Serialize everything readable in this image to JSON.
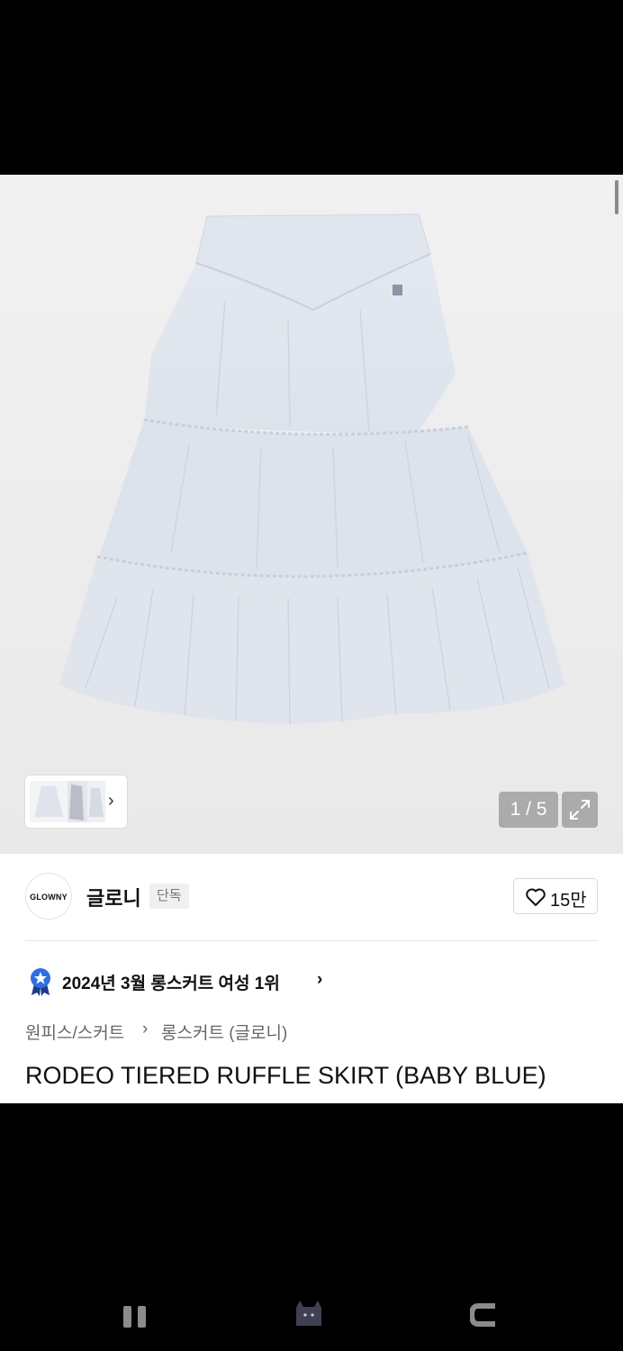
{
  "gallery": {
    "page_counter": "1 / 5",
    "current_image": 1,
    "total_images": 5,
    "product_color": "#dfe5ee"
  },
  "brand": {
    "logo_text": "GLOWNY",
    "name": "글로니",
    "badge": "단독"
  },
  "like": {
    "count": "15만"
  },
  "ranking": {
    "text": "2024년 3월 롱스커트 여성 1위",
    "chevron": "›"
  },
  "breadcrumb": {
    "category": "원피스/스커트",
    "separator": "›",
    "subcategory": "롱스커트 (글로니)"
  },
  "product": {
    "title": "RODEO TIERED RUFFLE SKIRT (BABY BLUE)"
  },
  "icons": {
    "thumbnail_next": "›",
    "expand": "expand-icon",
    "heart": "heart-icon",
    "ranking": "ribbon-badge-icon",
    "recents": "recent-apps-icon",
    "home": "home-icon",
    "back": "back-icon"
  }
}
